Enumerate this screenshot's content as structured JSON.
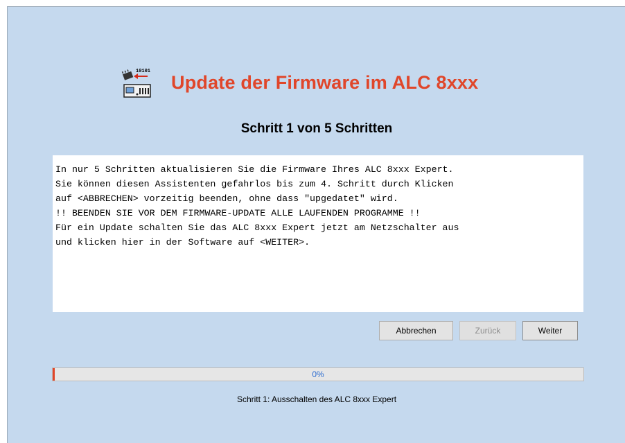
{
  "header": {
    "title": "Update der Firmware im ALC 8xxx",
    "icon": "firmware-update-icon",
    "title_color": "#e0462a"
  },
  "step_heading": "Schritt 1 von 5 Schritten",
  "info_lines": [
    "In nur 5 Schritten aktualisieren Sie die Firmware Ihres ALC 8xxx Expert.",
    "Sie können diesen Assistenten gefahrlos bis zum 4. Schritt durch Klicken",
    "auf <ABBRECHEN> vorzeitig beenden, ohne dass \"upgedatet\" wird.",
    "!! BEENDEN SIE VOR DEM FIRMWARE-UPDATE ALLE LAUFENDEN PROGRAMME !!",
    "Für ein Update schalten Sie das ALC 8xxx Expert jetzt am Netzschalter aus",
    "und klicken hier in der Software auf <WEITER>."
  ],
  "buttons": {
    "cancel": "Abbrechen",
    "back": "Zurück",
    "next": "Weiter"
  },
  "progress": {
    "value_percent": 0,
    "label": "0%"
  },
  "status_text": "Schritt 1: Ausschalten des ALC 8xxx Expert",
  "colors": {
    "background": "#c5d9ee",
    "accent": "#e0462a",
    "progress_text": "#2a6bd0"
  }
}
